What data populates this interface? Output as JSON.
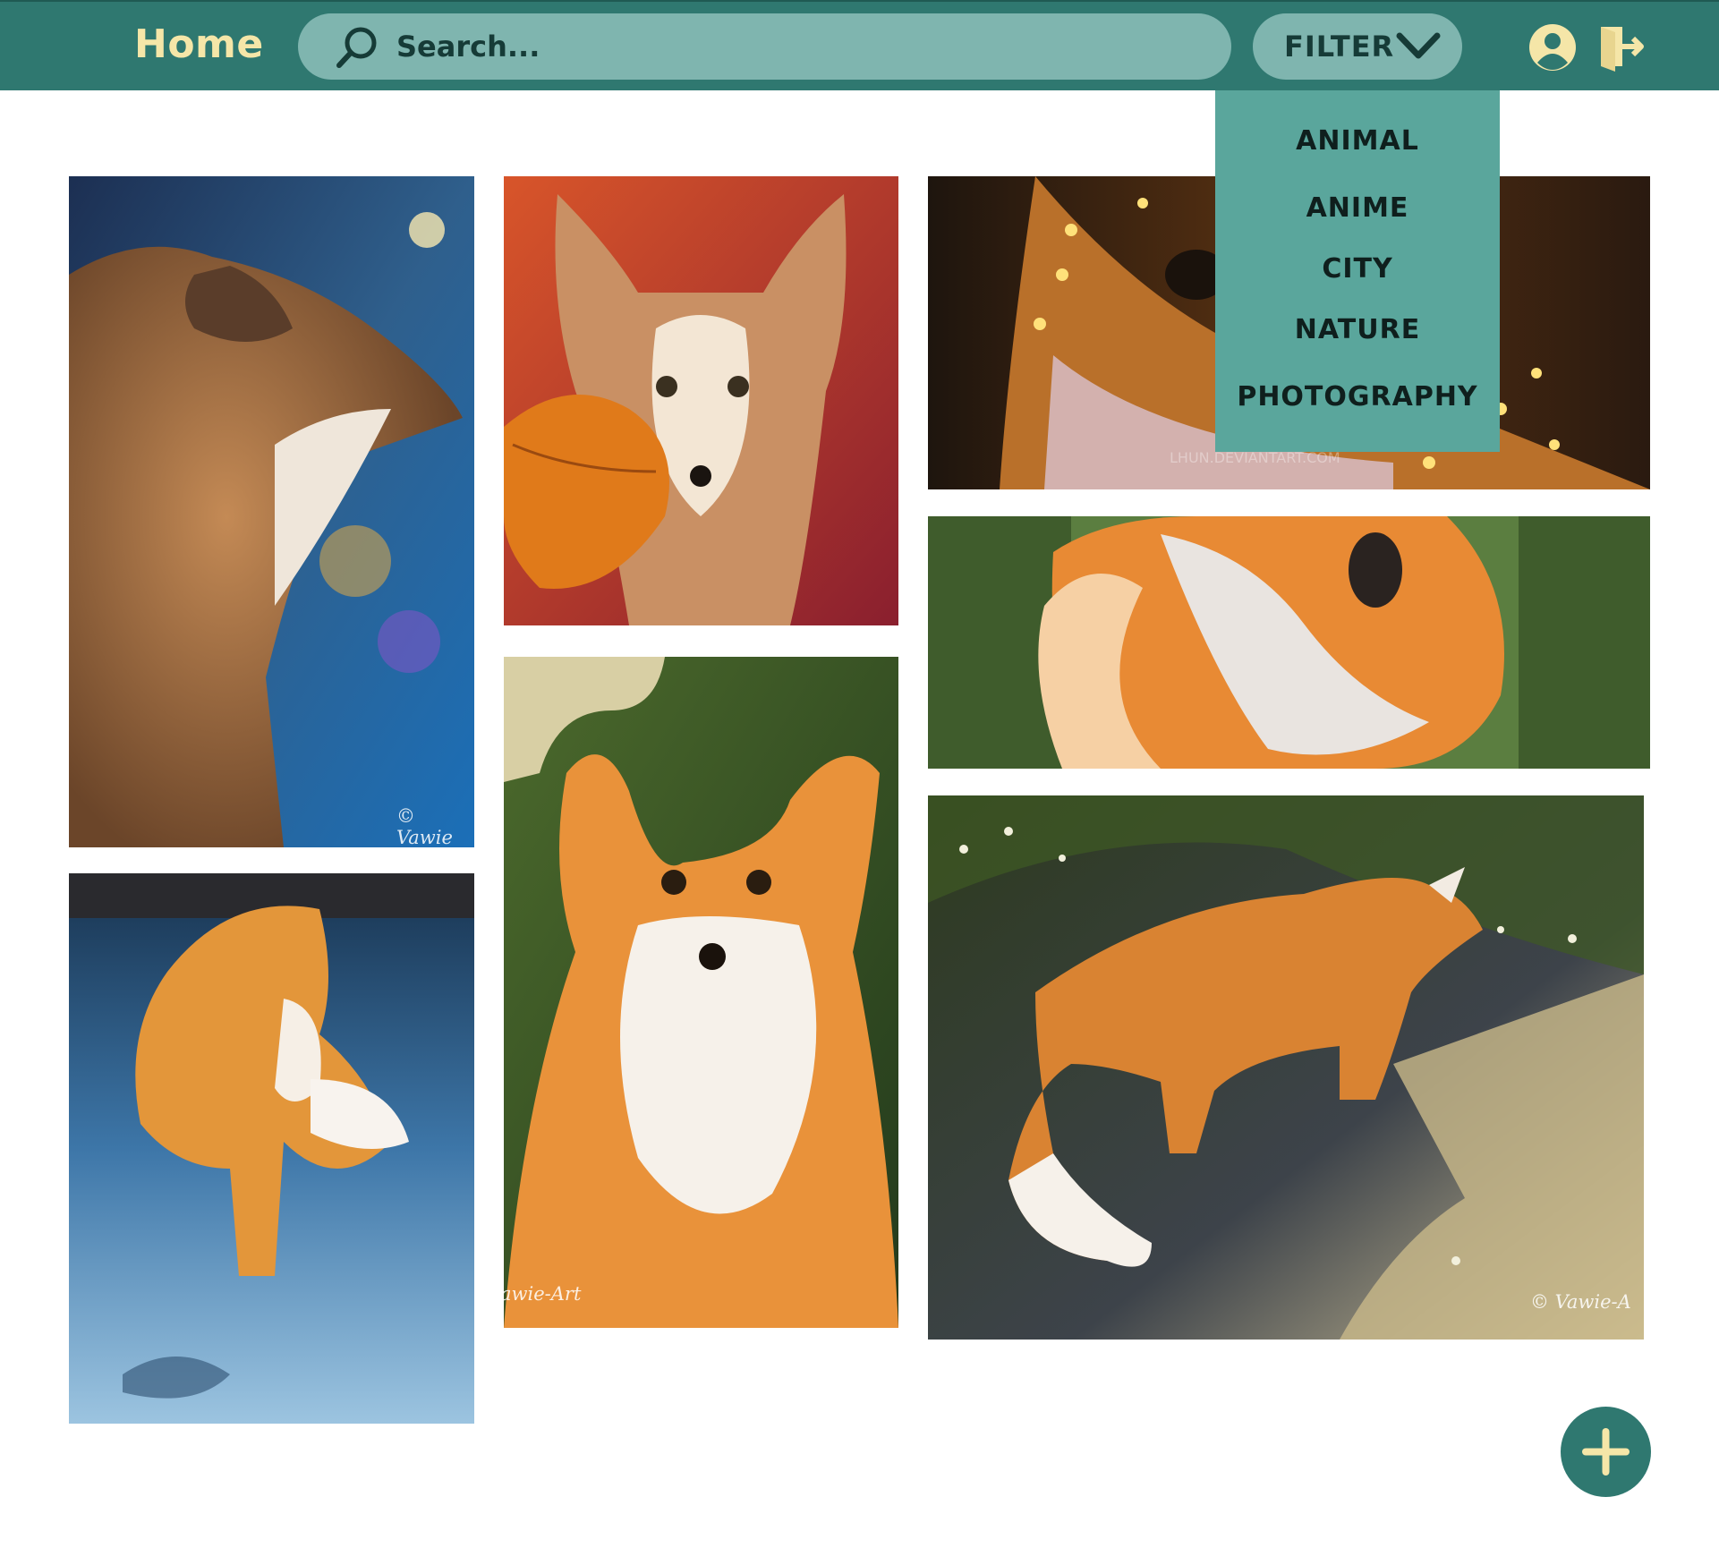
{
  "header": {
    "home_label": "Home",
    "search_placeholder": "Search...",
    "filter_label": "FILTER"
  },
  "filter_menu": {
    "options": [
      "ANIMAL",
      "ANIME",
      "CITY",
      "NATURE",
      "PHOTOGRAPHY"
    ]
  },
  "gallery": {
    "watermarks": [
      "© Vawie",
      "awie-Art",
      "© Vawie-A",
      "LHUN.DEVIANTART.COM"
    ]
  },
  "icons": {
    "search": "search-icon",
    "filter_chevron": "chevron-down-icon",
    "user": "user-icon",
    "logout": "logout-icon",
    "add": "plus-icon"
  },
  "colors": {
    "topbar": "#2f7870",
    "search_bg": "#7fb5af",
    "home_text": "#f5e6a8",
    "dropdown_bg": "#5aa69c",
    "fab": "#2f7870"
  }
}
